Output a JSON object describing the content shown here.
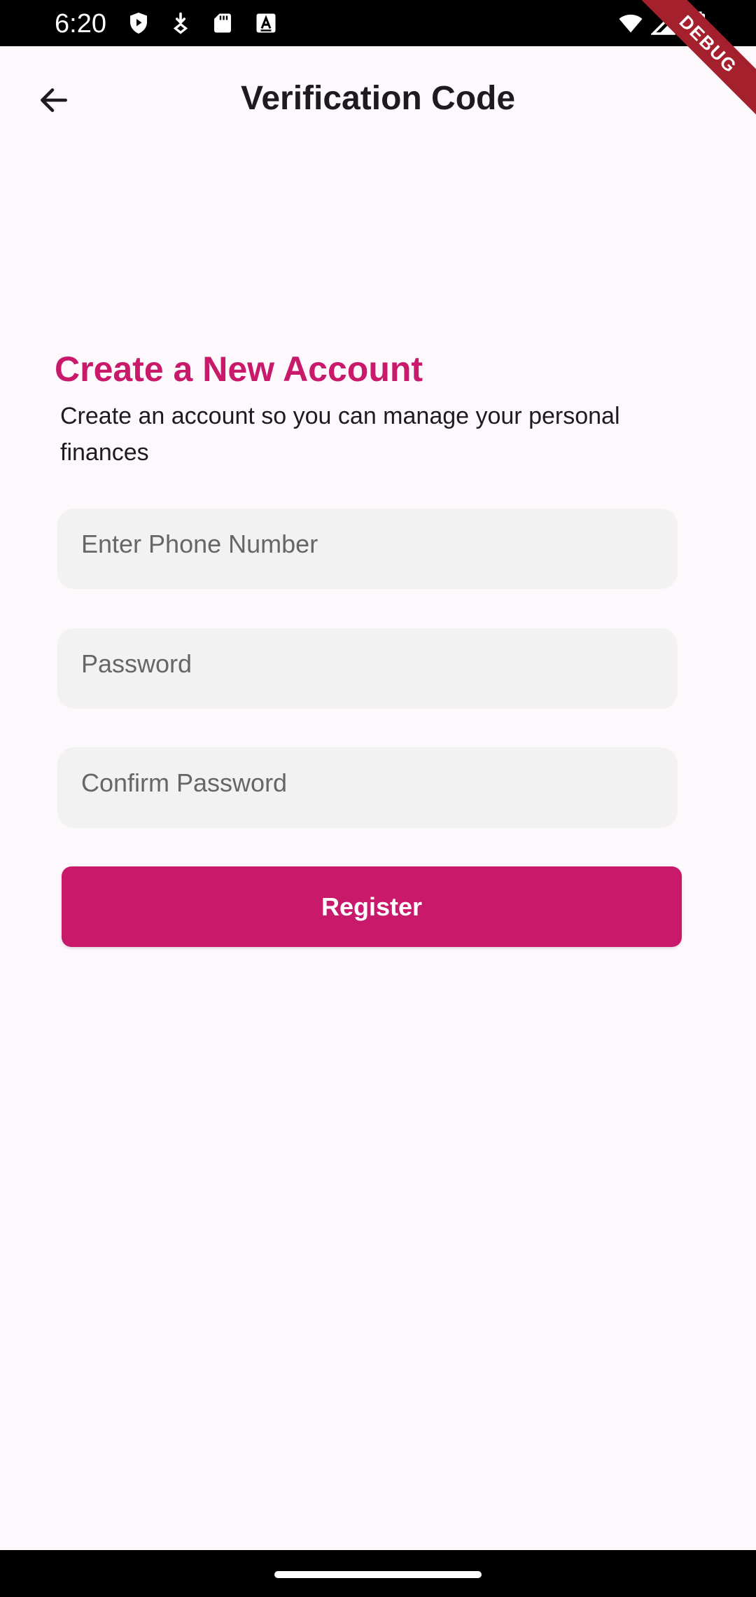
{
  "status_bar": {
    "time": "6:20",
    "left_icons": [
      "shield-play-icon",
      "download-location-icon",
      "sd-card-icon",
      "keyboard-a-icon"
    ],
    "right_icons": [
      "wifi-icon",
      "signal-icon",
      "battery-icon"
    ]
  },
  "debug_banner": "DEBUG",
  "app_bar": {
    "title": "Verification Code",
    "back_icon": "arrow-back-icon"
  },
  "form": {
    "heading": "Create a New Account",
    "subtitle": "Create an account so you can manage your personal finances",
    "phone_placeholder": "Enter Phone Number",
    "password_placeholder": "Password",
    "confirm_password_placeholder": "Confirm Password",
    "register_label": "Register"
  },
  "colors": {
    "accent": "#c8196b",
    "background": "#fdf8fc",
    "field_bg": "#f2f2f2"
  }
}
